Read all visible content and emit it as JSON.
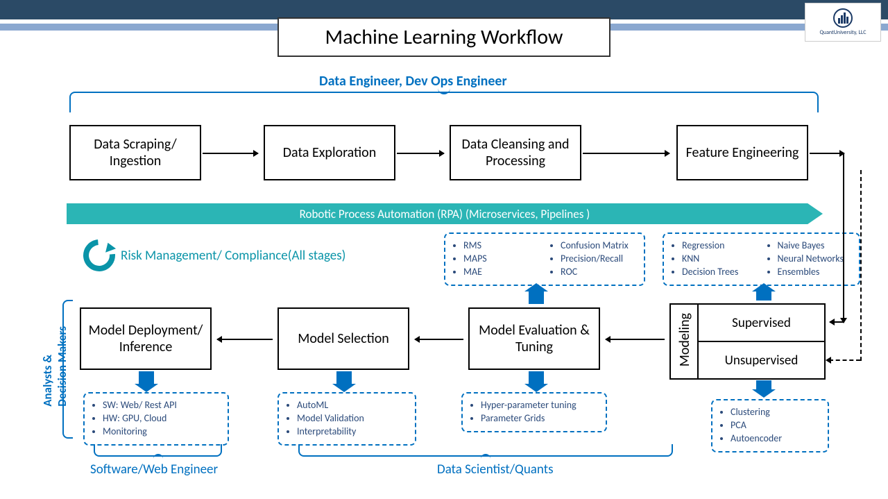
{
  "title": "Machine Learning Workflow",
  "logo": {
    "line1": "QuantUniversity, LLC"
  },
  "roles": {
    "top": "Data Engineer, Dev Ops Engineer",
    "left": "Analysts &\nDecision Makers",
    "bottom_left": "Software/Web Engineer",
    "bottom_right": "Data Scientist/Quants"
  },
  "stages_top": [
    "Data Scraping/ Ingestion",
    "Data Exploration",
    "Data Cleansing and Processing",
    "Feature Engineering"
  ],
  "rpa_banner": "Robotic Process Automation (RPA) (Microservices, Pipelines )",
  "risk": "Risk Management/ Compliance(All stages)",
  "stages_bottom": [
    "Model Deployment/ Inference",
    "Model Selection",
    "Model Evaluation & Tuning"
  ],
  "modeling": {
    "label": "Modeling",
    "supervised": "Supervised",
    "unsupervised": "Unsupervised"
  },
  "details": {
    "metrics": {
      "col1": [
        "RMS",
        "MAPS",
        "MAE"
      ],
      "col2": [
        "Confusion Matrix",
        "Precision/Recall",
        "ROC"
      ]
    },
    "supervised_algos": {
      "col1": [
        "Regression",
        "KNN",
        "Decision Trees"
      ],
      "col2": [
        "Naive Bayes",
        "Neural Networks",
        "Ensembles"
      ]
    },
    "deployment": [
      "SW: Web/ Rest API",
      "HW: GPU, Cloud",
      "Monitoring"
    ],
    "selection": [
      "AutoML",
      "Model Validation",
      "Interpretability"
    ],
    "tuning": [
      "Hyper-parameter tuning",
      "Parameter Grids"
    ],
    "unsupervised_algos": [
      "Clustering",
      "PCA",
      "Autoencoder"
    ]
  }
}
